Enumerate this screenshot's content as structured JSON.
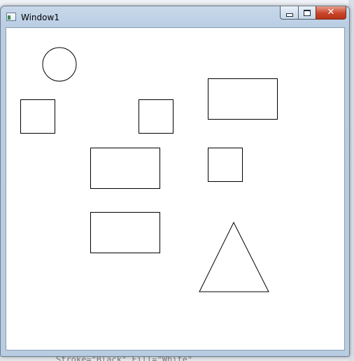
{
  "window": {
    "title": "Window1",
    "icon": "wpf-window-icon",
    "buttons": {
      "minimize": "minimize-icon",
      "maximize": "maximize-icon",
      "close": "close-icon"
    },
    "close_glyph": "✕"
  },
  "canvas": {
    "stroke": "#000000",
    "fill": "#ffffff",
    "shape_kinds": [
      "ellipse",
      "rectangle",
      "rectangle",
      "rectangle",
      "rectangle",
      "rectangle",
      "rectangle",
      "polygon"
    ]
  },
  "background": {
    "code_snippet": "Stroke=\"Black\" Fill=\"White\""
  }
}
